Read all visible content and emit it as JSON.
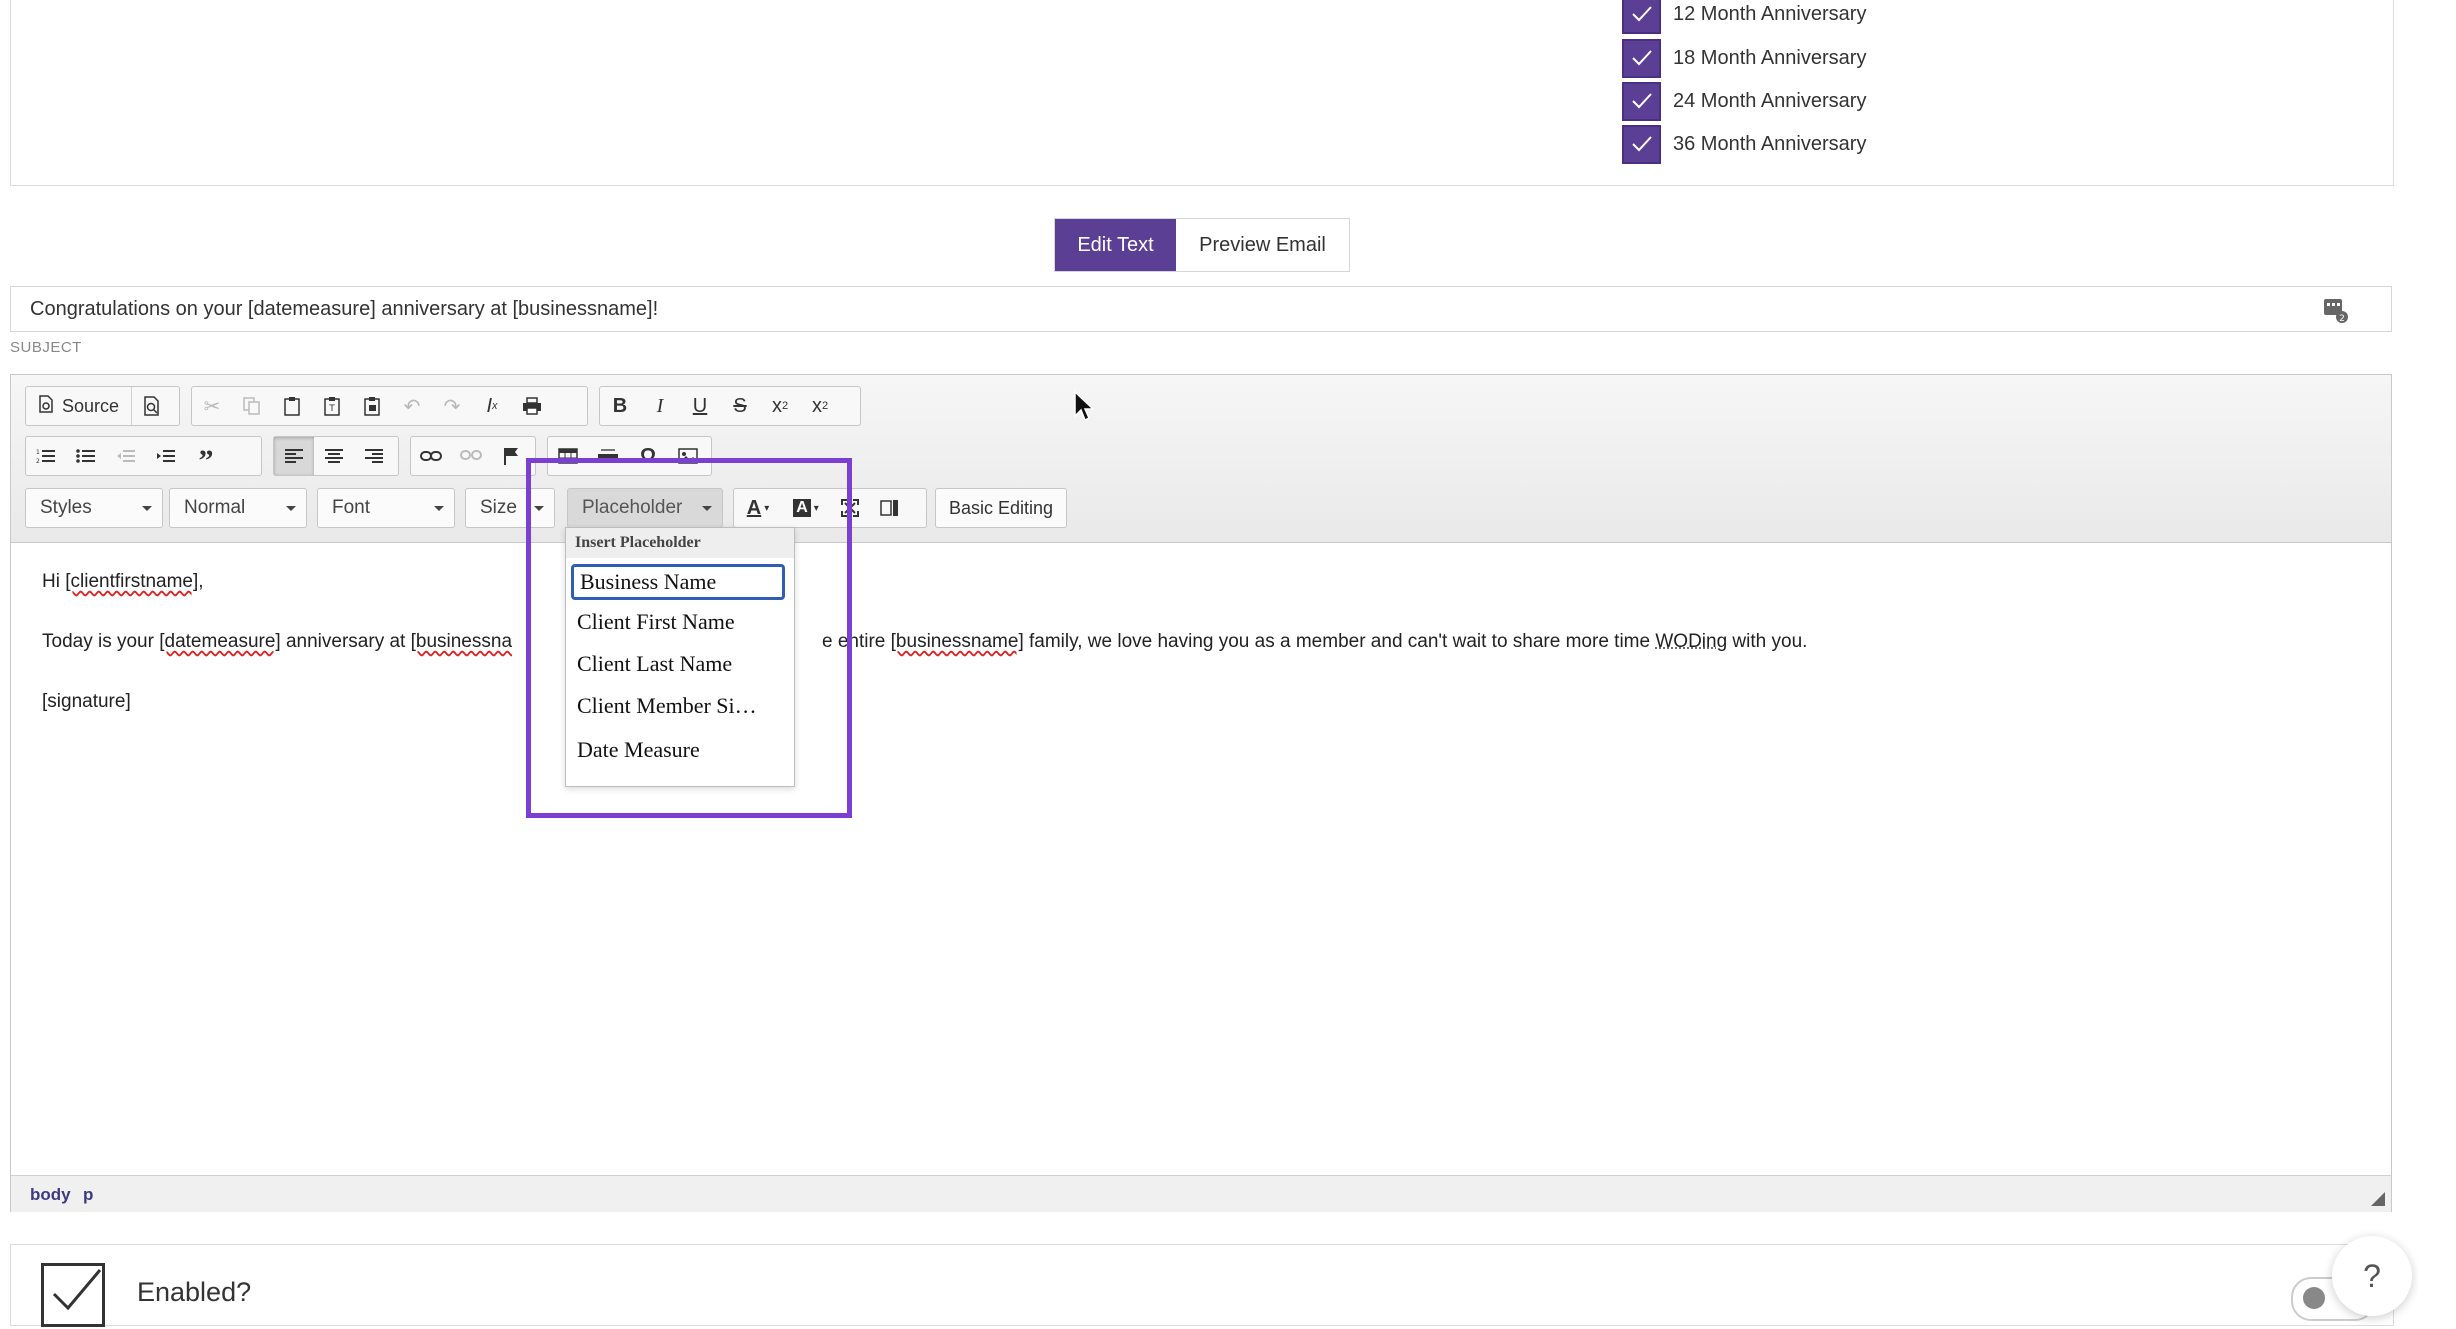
{
  "anniversaries": [
    {
      "label": "12 Month Anniversary",
      "checked": true
    },
    {
      "label": "18 Month Anniversary",
      "checked": true
    },
    {
      "label": "24 Month Anniversary",
      "checked": true
    },
    {
      "label": "36 Month Anniversary",
      "checked": true
    }
  ],
  "mode_tabs": {
    "edit": "Edit Text",
    "preview": "Preview Email",
    "active": "edit"
  },
  "subject": {
    "value": "Congratulations on your [datemeasure] anniversary at [businessname]!",
    "label": "SUBJECT"
  },
  "toolbar": {
    "source_label": "Source",
    "styles_label": "Styles",
    "format_label": "Normal",
    "font_label": "Font",
    "size_label": "Size",
    "placeholder_label": "Placeholder",
    "basic_editing_label": "Basic Editing"
  },
  "body": {
    "line1_pre": "Hi ",
    "line1_var": "[clientfirstname]",
    "line1_post": ",",
    "line2_a": "Today is your ",
    "line2_b": "[datemeasure]",
    "line2_c": " anniversary at ",
    "line2_d": "[businessna",
    "line2_e": "e entire ",
    "line2_f": "[businessname]",
    "line2_g": " family, we love having you as a member and can't wait to share more time ",
    "line2_h": "WODing",
    "line2_i": " with you.",
    "line3": "[signature]"
  },
  "statusbar": {
    "path1": "body",
    "path2": "p"
  },
  "placeholder_menu": {
    "title": "Insert Placeholder",
    "options": [
      "Business Name",
      "Client First Name",
      "Client Last Name",
      "Client Member Si…",
      "Date Measure"
    ],
    "selected": "Business Name"
  },
  "enabled": {
    "label": "Enabled?",
    "checked": true
  },
  "help": {
    "label": "?"
  },
  "colors": {
    "accent": "#5b3f95",
    "highlight": "#7b3fd1",
    "selection": "#2f5fb3"
  }
}
